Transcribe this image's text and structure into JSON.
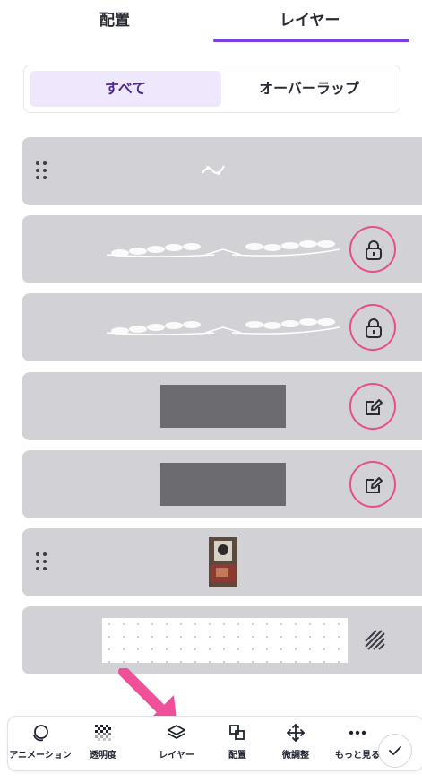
{
  "tabs": [
    {
      "label": "配置",
      "active": false
    },
    {
      "label": "レイヤー",
      "active": true
    }
  ],
  "filter": {
    "all_label": "すべて",
    "overlap_label": "オーバーラップ"
  },
  "layers": [
    {
      "kind": "small-ornament",
      "action": "drag-handle"
    },
    {
      "kind": "laurel-divider",
      "action": "lock-icon"
    },
    {
      "kind": "laurel-divider",
      "action": "lock-icon"
    },
    {
      "kind": "grey-rectangle",
      "action": "edit-icon"
    },
    {
      "kind": "grey-rectangle",
      "action": "edit-icon"
    },
    {
      "kind": "photo",
      "action": "drag-handle"
    },
    {
      "kind": "dotted-background",
      "action": "transparency-pattern-icon"
    }
  ],
  "toolbar": {
    "items": [
      {
        "label": "アニメーション",
        "icon": "animation-icon"
      },
      {
        "label": "透明度",
        "icon": "transparency-icon"
      },
      {
        "label": "レイヤー",
        "icon": "layers-icon"
      },
      {
        "label": "配置",
        "icon": "position-icon"
      },
      {
        "label": "微調整",
        "icon": "nudge-icon"
      },
      {
        "label": "もっと見る",
        "icon": "more-icon"
      }
    ],
    "done_icon": "check-icon"
  },
  "colors": {
    "accent": "#7b3fe4",
    "highlight_ring": "#e84d86",
    "arrow": "#f0509a",
    "layer_bg": "#d1d1d6",
    "active_filter_bg": "#efe8fd"
  }
}
